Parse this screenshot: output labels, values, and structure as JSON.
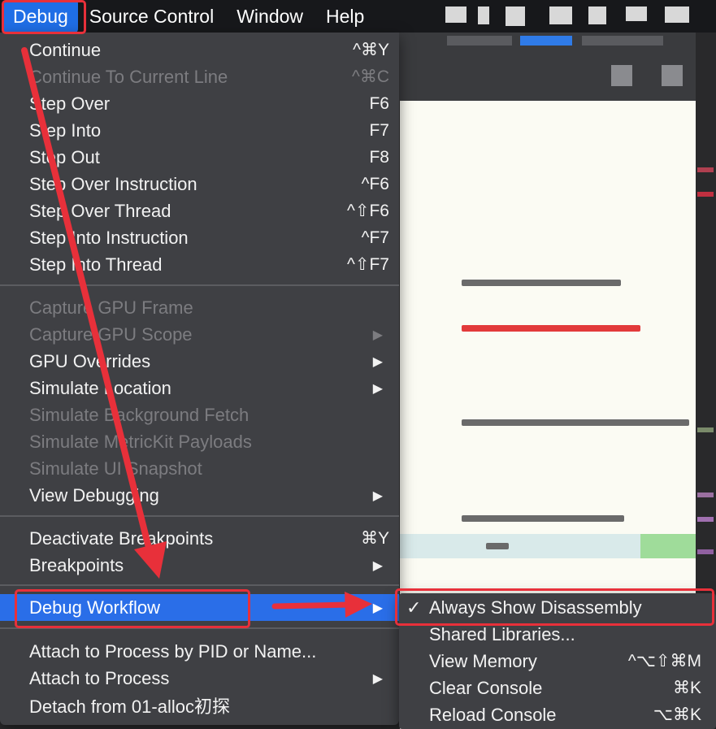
{
  "menubar": {
    "items": [
      "Debug",
      "Source Control",
      "Window",
      "Help"
    ]
  },
  "debug_menu": {
    "items": [
      {
        "label": "Continue",
        "shortcut": "^⌘Y",
        "enabled": true
      },
      {
        "label": "Continue To Current Line",
        "shortcut": "^⌘C",
        "enabled": false
      },
      {
        "label": "Step Over",
        "shortcut": "F6",
        "enabled": true
      },
      {
        "label": "Step Into",
        "shortcut": "F7",
        "enabled": true
      },
      {
        "label": "Step Out",
        "shortcut": "F8",
        "enabled": true
      },
      {
        "label": "Step Over Instruction",
        "shortcut": "^F6",
        "enabled": true
      },
      {
        "label": "Step Over Thread",
        "shortcut": "^⇧F6",
        "enabled": true
      },
      {
        "label": "Step Into Instruction",
        "shortcut": "^F7",
        "enabled": true
      },
      {
        "label": "Step Into Thread",
        "shortcut": "^⇧F7",
        "enabled": true
      },
      {
        "label": "Capture GPU Frame",
        "enabled": false
      },
      {
        "label": "Capture GPU Scope",
        "enabled": false,
        "submenu": true
      },
      {
        "label": "GPU Overrides",
        "enabled": true,
        "submenu": true
      },
      {
        "label": "Simulate Location",
        "enabled": true,
        "submenu": true
      },
      {
        "label": "Simulate Background Fetch",
        "enabled": false
      },
      {
        "label": "Simulate MetricKit Payloads",
        "enabled": false
      },
      {
        "label": "Simulate UI Snapshot",
        "enabled": false
      },
      {
        "label": "View Debugging",
        "enabled": true,
        "submenu": true
      },
      {
        "label": "Deactivate Breakpoints",
        "shortcut": "⌘Y",
        "enabled": true
      },
      {
        "label": "Breakpoints",
        "enabled": true,
        "submenu": true
      },
      {
        "label": "Debug Workflow",
        "enabled": true,
        "submenu": true,
        "selected": true
      },
      {
        "label": "Attach to Process by PID or Name...",
        "enabled": true
      },
      {
        "label": "Attach to Process",
        "enabled": true,
        "submenu": true
      },
      {
        "label": "Detach from 01-alloc初探",
        "enabled": true
      }
    ]
  },
  "debug_workflow_submenu": {
    "items": [
      {
        "label": "Always Show Disassembly",
        "checked": true
      },
      {
        "label": "Shared Libraries..."
      },
      {
        "label": "View Memory",
        "shortcut": "^⌥⇧⌘M"
      },
      {
        "label": "Clear Console",
        "shortcut": "⌘K"
      },
      {
        "label": "Reload Console",
        "shortcut": "⌥⌘K"
      }
    ]
  },
  "glyphs": {
    "submenu_arrow": "▶",
    "checkmark": "✓"
  },
  "colors": {
    "menu_bg": "#3f4044",
    "selection": "#2a6ee8",
    "annotation_red": "#e8303a",
    "disabled_text": "#7c7c80"
  }
}
